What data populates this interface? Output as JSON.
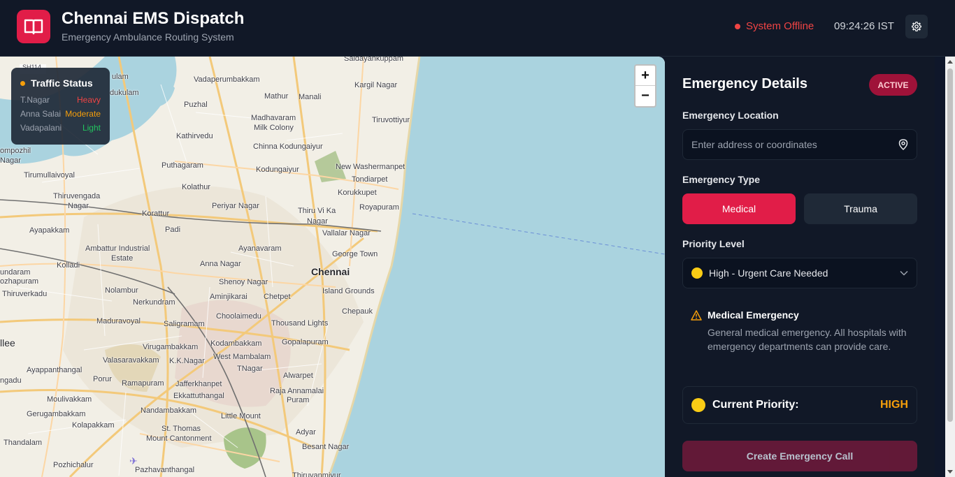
{
  "header": {
    "title": "Chennai EMS Dispatch",
    "subtitle": "Emergency Ambulance Routing System",
    "status": "System Offline",
    "clock": "09:24:26 IST",
    "logo_icon": "book-icon",
    "settings_icon": "gear-icon"
  },
  "map": {
    "zoom_in": "+",
    "zoom_out": "−",
    "labels": {
      "saidayankuppam": "Saidayankuppam",
      "vadaperumbakkam": "Vadaperumbakkam",
      "kargil_nagar": "Kargil Nagar",
      "mathur": "Mathur",
      "manali": "Manali",
      "puzhal": "Puzhal",
      "madhavaram": "Madhavaram",
      "milk_colony": "Milk Colony",
      "tiruvottiyur": "Tiruvottiyur",
      "kathirvedu": "Kathirvedu",
      "chinna_kodungaiyur": "Chinna Kodungaiyur",
      "puthagaram": "Puthagaram",
      "kodungaiyur": "Kodungaiyur",
      "new_washermanpet": "New Washermanpet",
      "tondiarpet": "Tondiarpet",
      "tirumullaivoyal": "Tirumullaivoyal",
      "kolathur": "Kolathur",
      "korukkupet": "Korukkupet",
      "thiruvengada": "Thiruvengada",
      "nagar_1": "Nagar",
      "periyar_nagar": "Periyar Nagar",
      "royapuram": "Royapuram",
      "korattur": "Korattur",
      "thiru_vi_ka": "Thiru Vi Ka",
      "nagar_2": "Nagar",
      "padi": "Padi",
      "vallalar_nagar": "Vallalar Nagar",
      "ayapakkam": "Ayapakkam",
      "ambattur_industrial": "Ambattur Industrial",
      "estate": "Estate",
      "ayanavaram": "Ayanavaram",
      "george_town": "George Town",
      "kolladi": "Kolladi",
      "anna_nagar": "Anna Nagar",
      "chennai": "Chennai",
      "shenoy_nagar": "Shenoy Nagar",
      "island_grounds": "Island Grounds",
      "nolambur": "Nolambur",
      "aminjikarai": "Aminjikarai",
      "chetpet": "Chetpet",
      "thiruverkadu": "Thiruverkadu",
      "nerkundram": "Nerkundram",
      "chepauk": "Chepauk",
      "maduravoyal": "Maduravoyal",
      "choolaimedu": "Choolaimedu",
      "thousand_lights": "Thousand Lights",
      "saligramam": "Saligramam",
      "llee": "llee",
      "virugambakkam": "Virugambakkam",
      "kodambakkam": "Kodambakkam",
      "gopalapuram": "Gopalapuram",
      "west_mambalam": "West Mambalam",
      "valasaravakkam": "Valasaravakkam",
      "kk_nagar": "K.K.Nagar",
      "ayappanthangal": "Ayappanthangal",
      "porur": "Porur",
      "tnagar": "TNagar",
      "alwarpet": "Alwarpet",
      "ramapuram": "Ramapuram",
      "jafferkhanpet": "Jafferkhanpet",
      "raja_annamalai": "Raja Annamalai",
      "puram": "Puram",
      "ekkattuthangal": "Ekkattuthangal",
      "moulivakkam": "Moulivakkam",
      "gerugambakkam": "Gerugambakkam",
      "nandambakkam": "Nandambakkam",
      "little_mount": "Little Mount",
      "kolapakkam": "Kolapakkam",
      "st_thomas": "St. Thomas",
      "mount_cantonment": "Mount Cantonment",
      "adyar": "Adyar",
      "thandalam": "Thandalam",
      "besant_nagar": "Besant Nagar",
      "pozhichalur": "Pozhichalur",
      "pazhavanthangal": "Pazhavanthangal",
      "thiruvanmiyur": "Thiruvanmiyur",
      "ompozhil": "ompozhil",
      "nagar_w": "Nagar",
      "ulam": "ulam",
      "dukulam": "dukulam",
      "undaram": "undaram",
      "ozhapuram": "ozhapuram",
      "ngadu": "ngadu",
      "sh114": "SH114"
    }
  },
  "traffic": {
    "title": "Traffic Status",
    "rows": [
      {
        "area": "T.Nagar",
        "level": "Heavy",
        "color": "#ef4444"
      },
      {
        "area": "Anna Salai",
        "level": "Moderate",
        "color": "#f59e0b"
      },
      {
        "area": "Vadapalani",
        "level": "Light",
        "color": "#22c55e"
      }
    ]
  },
  "panel": {
    "title": "Emergency Details",
    "badge": "ACTIVE",
    "location_label": "Emergency Location",
    "location_placeholder": "Enter address or coordinates",
    "type_label": "Emergency Type",
    "type_medical": "Medical",
    "type_trauma": "Trauma",
    "priority_label": "Priority Level",
    "priority_selected": "High - Urgent Care Needed",
    "info_title": "Medical Emergency",
    "info_body": "General medical emergency. All hospitals with emergency departments can provide care.",
    "current_priority_label": "Current Priority:",
    "current_priority_value": "HIGH",
    "create_button": "Create Emergency Call"
  },
  "colors": {
    "accent": "#e11d48",
    "warning": "#f59e0b",
    "offline": "#ef4444"
  }
}
